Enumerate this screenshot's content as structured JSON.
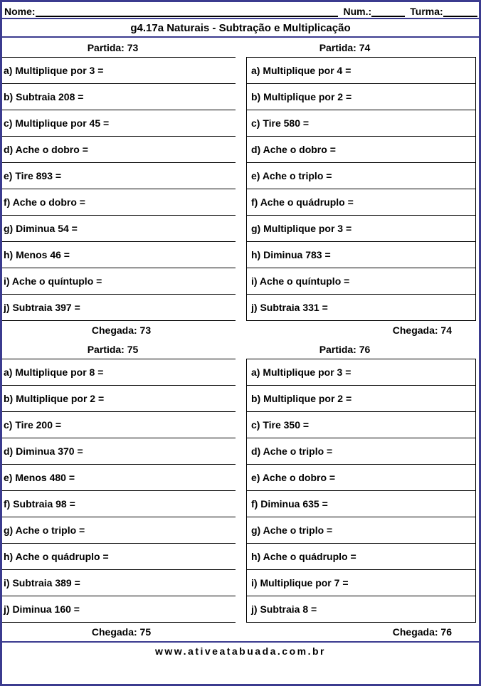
{
  "header": {
    "nome_label": "Nome:",
    "num_label": "Num.:",
    "turma_label": "Turma:",
    "title": "g4.17a Naturais - Subtração e Multiplicação"
  },
  "blocks": [
    {
      "partida_label": "Partida: 73",
      "chegada_label": "Chegada: 73",
      "items": [
        "a) Multiplique por 3 =",
        "b) Subtraia 208 =",
        "c) Multiplique por 45 =",
        "d) Ache o dobro  =",
        "e) Tire 893 =",
        "f) Ache o dobro  =",
        "g) Diminua 54 =",
        "h) Menos 46 =",
        "i) Ache o quíntuplo  =",
        "j) Subtraia 397 ="
      ]
    },
    {
      "partida_label": "Partida: 74",
      "chegada_label": "Chegada: 74",
      "items": [
        "a) Multiplique por 4 =",
        "b) Multiplique por 2 =",
        "c) Tire 580 =",
        "d) Ache o dobro  =",
        "e) Ache o triplo  =",
        "f) Ache o quádruplo  =",
        "g) Multiplique por 3 =",
        "h) Diminua 783 =",
        "i) Ache o quíntuplo  =",
        "j) Subtraia 331 ="
      ]
    },
    {
      "partida_label": "Partida: 75",
      "chegada_label": "Chegada: 75",
      "items": [
        "a) Multiplique por 8 =",
        "b) Multiplique por 2 =",
        "c) Tire 200 =",
        "d) Diminua 370 =",
        "e) Menos 480 =",
        "f) Subtraia 98 =",
        "g) Ache o triplo  =",
        "h) Ache o quádruplo  =",
        "i) Subtraia 389 =",
        "j) Diminua 160 ="
      ]
    },
    {
      "partida_label": "Partida: 76",
      "chegada_label": "Chegada: 76",
      "items": [
        "a) Multiplique por 3 =",
        "b) Multiplique por 2 =",
        "c) Tire 350 =",
        "d) Ache o triplo  =",
        "e) Ache o dobro  =",
        "f) Diminua 635 =",
        "g) Ache o triplo  =",
        "h) Ache o quádruplo  =",
        "i) Multiplique por 7 =",
        "j) Subtraia 8 ="
      ]
    }
  ],
  "footer": {
    "site": "www.ativeatabuada.com.br"
  },
  "colors": {
    "page_border": "#3b3b8f",
    "cell_border": "#000000",
    "text": "#000000"
  }
}
